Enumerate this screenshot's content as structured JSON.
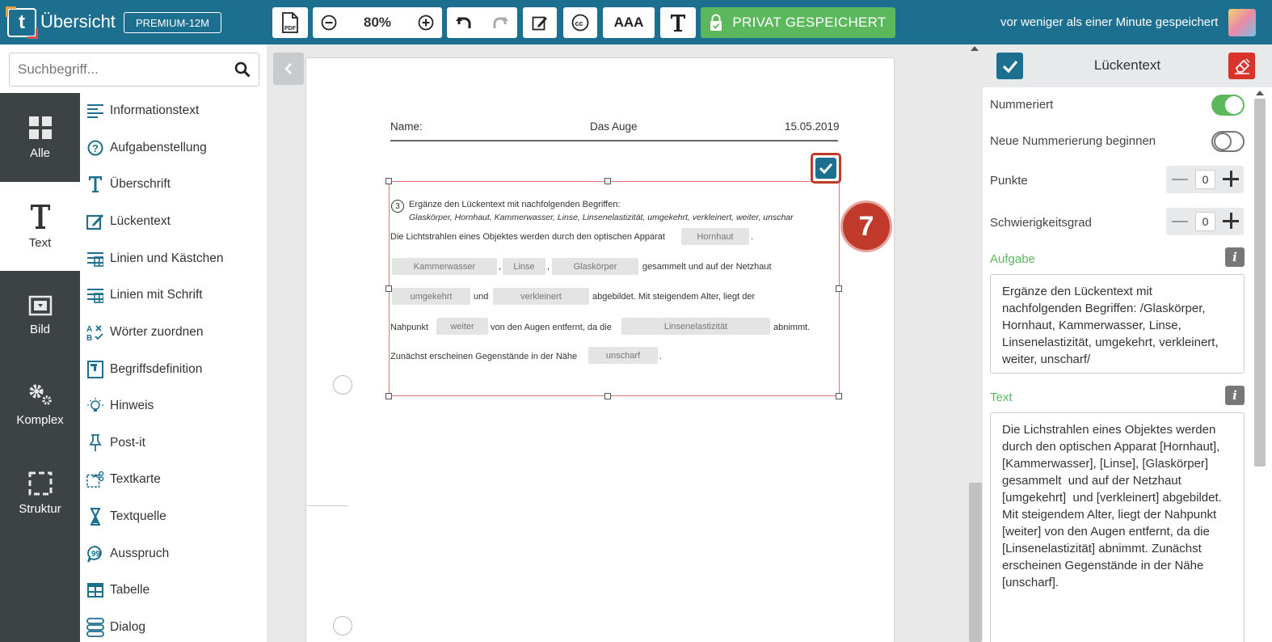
{
  "app": {
    "title": "Übersicht",
    "plan": "PREMIUM-12M",
    "zoom": "80%",
    "text_size_label": "AAA",
    "save_private_label": "PRIVAT GESPEICHERT",
    "save_status": "vor weniger als einer Minute gespeichert",
    "icons": [
      "pdf-icon",
      "zoom-out-icon",
      "zoom-in-icon",
      "undo-icon",
      "redo-icon",
      "edit-icon",
      "cc-icon",
      "font-icon",
      "lock-icon"
    ]
  },
  "search": {
    "placeholder": "Suchbegriff..."
  },
  "categories": [
    {
      "label": "Alle",
      "icon": "grid-icon"
    },
    {
      "label": "Text",
      "icon": "text-icon",
      "active": true
    },
    {
      "label": "Bild",
      "icon": "image-icon"
    },
    {
      "label": "Komplex",
      "icon": "gears-icon"
    },
    {
      "label": "Struktur",
      "icon": "frame-icon"
    }
  ],
  "types": [
    {
      "label": "Informationstext",
      "icon": "lines-icon"
    },
    {
      "label": "Aufgabenstellung",
      "icon": "question-icon"
    },
    {
      "label": "Überschrift",
      "icon": "heading-icon"
    },
    {
      "label": "Lückentext",
      "icon": "edit-icon"
    },
    {
      "label": "Linien und Kästchen",
      "icon": "grid-lines-icon"
    },
    {
      "label": "Linien mit Schrift",
      "icon": "grid-lines-icon"
    },
    {
      "label": "Wörter zuordnen",
      "icon": "match-icon"
    },
    {
      "label": "Begriffsdefinition",
      "icon": "card-icon"
    },
    {
      "label": "Hinweis",
      "icon": "bulb-icon"
    },
    {
      "label": "Post-it",
      "icon": "pin-icon"
    },
    {
      "label": "Textkarte",
      "icon": "scissors-icon"
    },
    {
      "label": "Textquelle",
      "icon": "hourglass-icon"
    },
    {
      "label": "Ausspruch",
      "icon": "quote-icon"
    },
    {
      "label": "Tabelle",
      "icon": "table-icon"
    },
    {
      "label": "Dialog",
      "icon": "dialog-icon"
    }
  ],
  "worksheet": {
    "name_label": "Name:",
    "topic": "Das Auge",
    "date": "15.05.2019",
    "step_badge": "7",
    "task_number": "3",
    "instruction": "Ergänze den Lückentext mit nachfolgenden Begriffen:",
    "words": "Glaskörper, Hornhaut, Kammerwasser, Linse, Linsenelastizität, umgekehrt, verkleinert, weiter, unschar",
    "line1_text": "Die Lichtstrahlen eines Objektes werden durch den optischen Apparat",
    "line2_text": "gesammelt und auf der Netzhaut",
    "line3_und": "und",
    "line3_text": "abgebildet. Mit steigendem Alter, liegt der",
    "line4_a": "Nahpunkt",
    "line4_b": "von den Augen entfernt, da die",
    "line4_c": "abnimmt.",
    "line5_text": "Zunächst erscheinen Gegenstände in der Nähe",
    "period": ".",
    "comma": ",",
    "gaps": [
      "Hornhaut",
      "Kammerwasser",
      "Linse",
      "Glaskörper",
      "umgekehrt",
      "verkleinert",
      "weiter",
      "Linsenelastizität",
      "unscharf"
    ]
  },
  "panel": {
    "title": "Lückentext",
    "numbered_label": "Nummeriert",
    "numbered": true,
    "new_numbering_label": "Neue Nummerierung beginnen",
    "new_numbering": false,
    "points_label": "Punkte",
    "points": "0",
    "difficulty_label": "Schwierigkeitsgrad",
    "difficulty": "0",
    "task_label": "Aufgabe",
    "task_text": "Ergänze den Lückentext mit nachfolgenden Begriffen: /Glaskörper, Hornhaut, Kammerwasser, Linse, Linsenelastizität, umgekehrt, verkleinert, weiter, unscharf/",
    "text_label": "Text",
    "text_value": "Die Lichstrahlen eines Objektes werden durch den optischen Apparat [Hornhaut], [Kammerwasser], [Linse], [Glaskörper] gesammelt  und auf der Netzhaut [umgekehrt]  und [verkleinert] abgebildet. Mit steigendem Alter, liegt der Nahpunkt [weiter] von den Augen entfernt, da die [Linsenelastizität] abnimmt. Zunächst erscheinen Gegenstände in der Nähe [unscharf].",
    "info_glyph": "i"
  },
  "colors": {
    "brand": "#1d6f8f",
    "success": "#5cb85c",
    "danger": "#d9342b",
    "rail": "#3d4245"
  }
}
